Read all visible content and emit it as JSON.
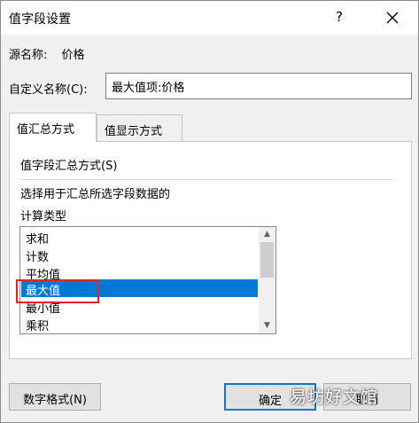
{
  "window": {
    "title": "值字段设置",
    "help_label": "?"
  },
  "source": {
    "label": "源名称:",
    "value": "价格"
  },
  "custom_name": {
    "label": "自定义名称(C):",
    "value": "最大值项:价格"
  },
  "tabs": [
    {
      "label": "值汇总方式",
      "active": true
    },
    {
      "label": "值显示方式",
      "active": false
    }
  ],
  "summary": {
    "group_label": "值字段汇总方式(S)",
    "description": "选择用于汇总所选字段数据的",
    "calc_label": "计算类型",
    "items": [
      "求和",
      "计数",
      "平均值",
      "最大值",
      "最小值",
      "乘积"
    ],
    "selected": "最大值"
  },
  "buttons": {
    "number_format": "数字格式(N)",
    "ok": "确定",
    "cancel": "取消"
  },
  "watermark": "易坊好文馆",
  "colors": {
    "selection": "#0078d7",
    "highlight_box": "#e0242c"
  }
}
